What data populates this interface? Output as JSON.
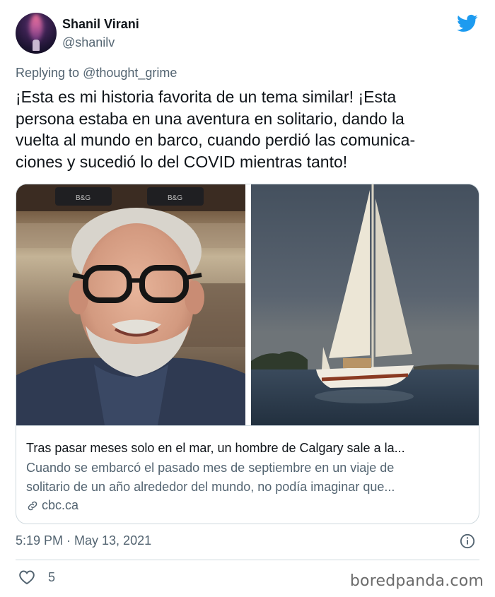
{
  "author": {
    "name": "Shanil Virani",
    "handle": "@shanilv"
  },
  "reply": {
    "prefix": "Replying to",
    "mention": "@thought_grime"
  },
  "tweet": {
    "lines": [
      "¡Esta es mi historia favorita de un tema similar! ¡Esta",
      "persona estaba en una aventura en solitario, dando la",
      "vuelta al mundo en barco, cuando perdió las comunica-",
      "ciones y sucedió lo del COVID mientras tanto!"
    ]
  },
  "card": {
    "title": "Tras pasar meses solo en el mar, un hombre de Calgary sale a la...",
    "description_lines": [
      "Cuando se embarcó el pasado mes de septiembre en un viaje de",
      "solitario de un año alrededor del mundo, no podía imaginar que..."
    ],
    "domain": "cbc.ca",
    "left_image": "man-with-glasses-photo",
    "right_image": "sailboat-photo",
    "left_labels": [
      "B&G",
      "B&G"
    ]
  },
  "meta": {
    "timestamp": "5:19 PM · May 13, 2021"
  },
  "engagement": {
    "likes": "5"
  },
  "watermark": "boredpanda.com",
  "colors": {
    "twitter_blue": "#1d9bf0",
    "secondary_text": "#536471",
    "border": "#cfd9de"
  }
}
